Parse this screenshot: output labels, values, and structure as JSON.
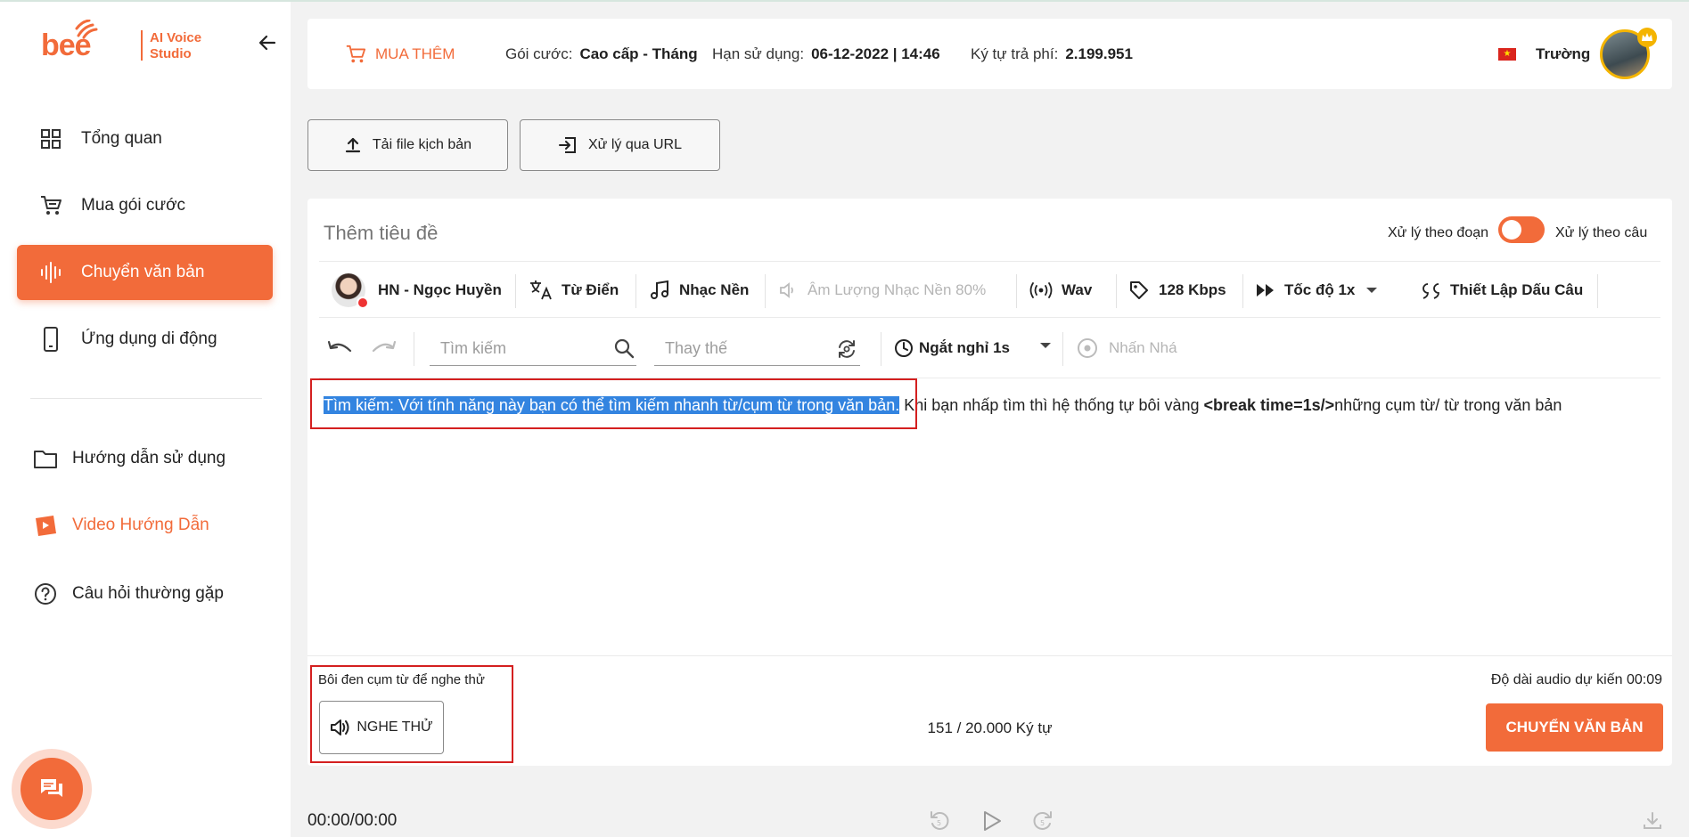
{
  "sidebar": {
    "logo": {
      "name": "bee",
      "line1": "AI Voice",
      "line2": "Studio"
    },
    "items": [
      {
        "label": "Tổng quan"
      },
      {
        "label": "Mua gói cước"
      },
      {
        "label": "Chuyển văn bản"
      },
      {
        "label": "Ứng dụng di động"
      },
      {
        "label": "Hướng dẫn sử dụng"
      },
      {
        "label": "Video Hướng Dẫn"
      },
      {
        "label": "Câu hỏi thường gặp"
      }
    ]
  },
  "header": {
    "buy_more": "MUA THÊM",
    "plan_label": "Gói cước:",
    "plan_value": "Cao cấp - Tháng",
    "expiry_label": "Hạn sử dụng:",
    "expiry_value": "06-12-2022 | 14:46",
    "chars_label": "Ký tự trả phí:",
    "chars_value": "2.199.951",
    "user_name": "Trường"
  },
  "upload": {
    "file_label": "Tải file kịch bản",
    "url_label": "Xử lý qua URL"
  },
  "editor": {
    "title_placeholder": "Thêm tiêu đề",
    "mode_paragraph": "Xử lý theo đoạn",
    "mode_sentence": "Xử lý theo câu",
    "toolbar": {
      "voice": "HN - Ngọc Huyền",
      "dictionary": "Từ Điển",
      "music": "Nhạc Nền",
      "music_volume": "Âm Lượng Nhạc Nền 80%",
      "format": "Wav",
      "bitrate": "128 Kbps",
      "speed": "Tốc độ 1x",
      "punctuation": "Thiết Lập Dấu Câu"
    },
    "search_placeholder": "Tìm kiếm",
    "replace_placeholder": "Thay thế",
    "pause": "Ngắt nghỉ 1s",
    "emphasis": "Nhấn Nhá",
    "text": {
      "highlighted": "Tìm kiếm: Với tính năng này bạn có thể tìm kiếm nhanh từ/cụm từ trong văn bản.",
      "part2": "Khi bạn nhấp tìm thì hệ thống tự bôi vàng ",
      "tag": "<break time=1s/>",
      "part3": "những cụm từ/ từ trong văn bản"
    },
    "hint": "Bôi đen cụm từ để nghe thử",
    "listen": "NGHE THỬ",
    "char_count": "151 / 20.000 Ký tự",
    "duration": "Độ dài audio dự kiến 00:09",
    "convert": "CHUYỂN VĂN BẢN"
  },
  "player": {
    "time": "00:00/00:00"
  },
  "colors": {
    "accent": "#f26b3a",
    "highlight": "#3384e0",
    "annotation": "#d42020"
  }
}
